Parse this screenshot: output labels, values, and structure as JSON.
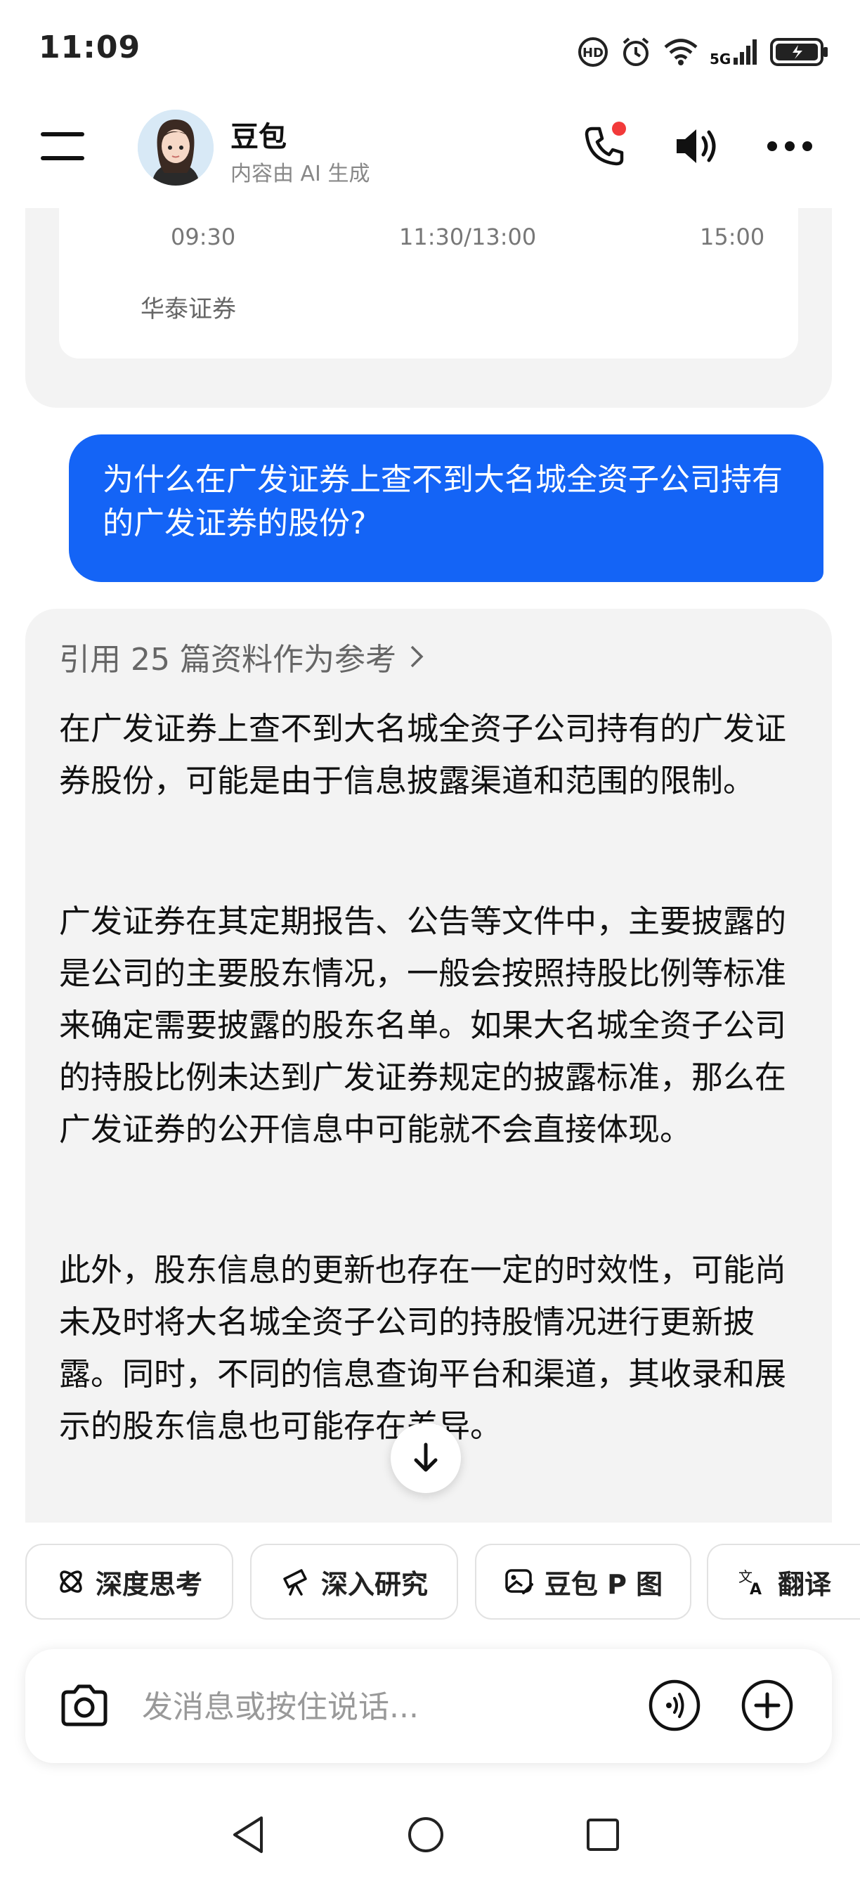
{
  "status_bar": {
    "time": "11:09",
    "network": "5G",
    "icons": [
      "hd-call-icon",
      "alarm-icon",
      "wifi-icon",
      "signal-icon",
      "battery-icon"
    ]
  },
  "header": {
    "name": "豆包",
    "subtitle": "内容由 AI 生成",
    "icons": [
      "menu-icon",
      "phone-icon",
      "speaker-icon",
      "more-icon"
    ],
    "notification_color": "#f23a3a"
  },
  "previous_card": {
    "ticks": [
      "09:30",
      "11:30/13:00",
      "15:00"
    ],
    "source": "华泰证券"
  },
  "user_message": {
    "text": "为什么在广发证券上查不到大名城全资子公司持有的广发证券的股份?",
    "color": "#1464f6"
  },
  "answer": {
    "references": "引用 25 篇资料作为参考",
    "paragraphs": [
      "在广发证券上查不到大名城全资子公司持有的广发证券股份，可能是由于信息披露渠道和范围的限制。",
      "广发证券在其定期报告、公告等文件中，主要披露的是公司的主要股东情况，一般会按照持股比例等标准来确定需要披露的股东名单。如果大名城全资子公司的持股比例未达到广发证券规定的披露标准，那么在广发证券的公开信息中可能就不会直接体现。",
      "此外，股东信息的更新也存在一定的时效性，可能尚未及时将大名城全资子公司的持股情况进行更新披露。同时，不同的信息查询平台和渠道，其收录和展示的股东信息也可能存在差异。"
    ]
  },
  "quick_actions": [
    {
      "label": "深度思考",
      "icon": "deep-think-icon"
    },
    {
      "label": "深入研究",
      "icon": "telescope-icon"
    },
    {
      "label": "豆包 P 图",
      "icon": "image-edit-icon"
    },
    {
      "label": "翻译",
      "icon": "translate-icon"
    }
  ],
  "input": {
    "placeholder": "发消息或按住说话..."
  },
  "nav": [
    "back-icon",
    "home-icon",
    "recents-icon"
  ]
}
